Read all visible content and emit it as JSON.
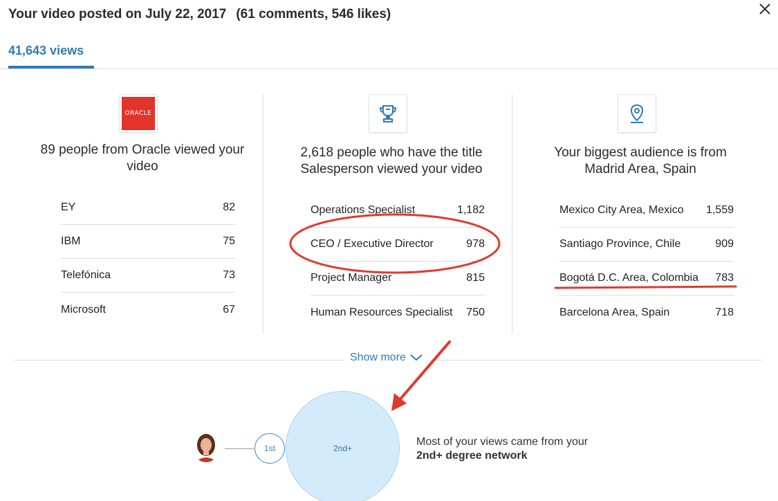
{
  "header": {
    "title": "Your video posted on July 22, 2017",
    "stats": "(61 comments, 546 likes)",
    "close_icon": "close-icon"
  },
  "tabs": {
    "views_label": "41,643 views"
  },
  "companies": {
    "logo_text": "ORACLE",
    "heading": "89 people from Oracle viewed your video",
    "rows": [
      {
        "name": "EY",
        "count": "82"
      },
      {
        "name": "IBM",
        "count": "75"
      },
      {
        "name": "Telefónica",
        "count": "73"
      },
      {
        "name": "Microsoft",
        "count": "67"
      }
    ]
  },
  "titles": {
    "icon": "trophy-icon",
    "heading": "2,618 people who have the title Salesperson viewed your video",
    "rows": [
      {
        "name": "Operations Specialist",
        "count": "1,182"
      },
      {
        "name": "CEO / Executive Director",
        "count": "978"
      },
      {
        "name": "Project Manager",
        "count": "815"
      },
      {
        "name": "Human Resources Specialist",
        "count": "750"
      }
    ]
  },
  "locations": {
    "icon": "location-pin-icon",
    "heading": "Your biggest audience is from Madrid Area, Spain",
    "rows": [
      {
        "name": "Mexico City Area, Mexico",
        "count": "1,559"
      },
      {
        "name": "Santiago Province, Chile",
        "count": "909"
      },
      {
        "name": "Bogotá D.C. Area, Colombia",
        "count": "783"
      },
      {
        "name": "Barcelona Area, Spain",
        "count": "718"
      }
    ]
  },
  "show_more": {
    "label": "Show more",
    "icon": "chevron-down-icon"
  },
  "network": {
    "first_label": "1st",
    "second_label": "2nd+",
    "text_line1": "Most of your views came from your",
    "text_line2": "2nd+ degree network"
  },
  "colors": {
    "accent": "#2f7bb7",
    "annotation_red": "#e0392e",
    "oracle_red": "#e2342a",
    "bubble_fill": "#d3ebfb"
  }
}
